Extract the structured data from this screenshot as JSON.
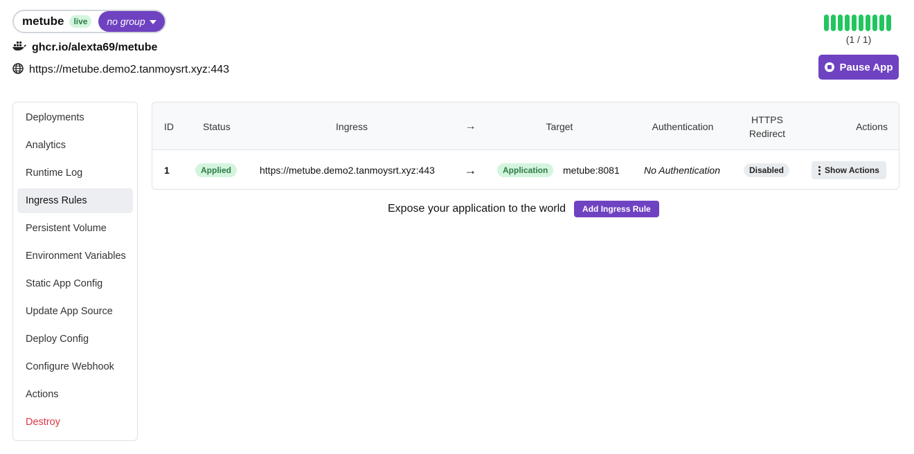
{
  "app": {
    "name": "metube",
    "status_badge": "live",
    "group_label": "no group",
    "image": "ghcr.io/alexta69/metube",
    "url": "https://metube.demo2.tanmoysrt.xyz:443",
    "health_count": "(1 / 1)",
    "pause_label": "Pause App"
  },
  "sidebar": {
    "items": [
      {
        "label": "Deployments"
      },
      {
        "label": "Analytics"
      },
      {
        "label": "Runtime Log"
      },
      {
        "label": "Ingress Rules"
      },
      {
        "label": "Persistent Volume"
      },
      {
        "label": "Environment Variables"
      },
      {
        "label": "Static App Config"
      },
      {
        "label": "Update App Source"
      },
      {
        "label": "Deploy Config"
      },
      {
        "label": "Configure Webhook"
      },
      {
        "label": "Actions"
      },
      {
        "label": "Destroy"
      }
    ],
    "active": "Ingress Rules"
  },
  "table": {
    "headers": {
      "id": "ID",
      "status": "Status",
      "ingress": "Ingress",
      "arrow": "→",
      "target": "Target",
      "authentication": "Authentication",
      "https_redirect_line1": "HTTPS",
      "https_redirect_line2": "Redirect",
      "actions": "Actions"
    },
    "rows": [
      {
        "id": "1",
        "status": "Applied",
        "ingress": "https://metube.demo2.tanmoysrt.xyz:443",
        "arrow": "→",
        "target_type": "Application",
        "target": "metube:8081",
        "authentication": "No Authentication",
        "https_redirect": "Disabled",
        "actions": "Show Actions"
      }
    ]
  },
  "cta": {
    "text": "Expose your application to the world",
    "button": "Add Ingress Rule"
  },
  "colors": {
    "primary": "#6f42c1",
    "success_bg": "#d3f5de",
    "success_text": "#2f7a46",
    "health": "#22c55e",
    "danger": "#dc3545"
  },
  "icons": {
    "image": "docker-icon",
    "url": "globe-icon",
    "pause": "stop-circle-icon",
    "group": "caret-down-icon",
    "actions": "kebab-icon"
  }
}
